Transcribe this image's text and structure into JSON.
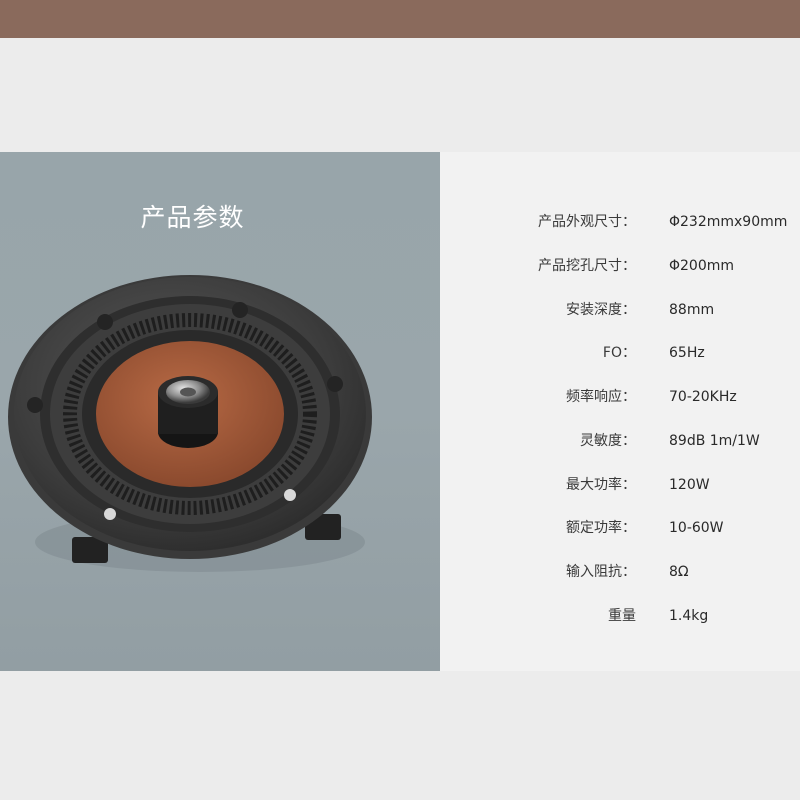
{
  "panel": {
    "title": "产品参数"
  },
  "specs": [
    {
      "label": "产品外观尺寸：",
      "value": "Φ232mmx90mm"
    },
    {
      "label": "产品挖孔尺寸：",
      "value": "Φ200mm"
    },
    {
      "label": "安装深度：",
      "value": "88mm"
    },
    {
      "label": "FO：",
      "value": "65Hz"
    },
    {
      "label": "频率响应：",
      "value": "70-20KHz"
    },
    {
      "label": "灵敏度：",
      "value": "89dB  1m/1W"
    },
    {
      "label": "最大功率：",
      "value": "120W"
    },
    {
      "label": "额定功率：",
      "value": "10-60W"
    },
    {
      "label": "输入阻抗：",
      "value": "8Ω"
    },
    {
      "label": "重量",
      "value": "1.4kg"
    }
  ],
  "colors": {
    "top_bar": "#8a6a5c",
    "image_bg": "#98a5aa",
    "spec_bg": "#f2f2f2",
    "woofer_cone": "#a0583a"
  }
}
